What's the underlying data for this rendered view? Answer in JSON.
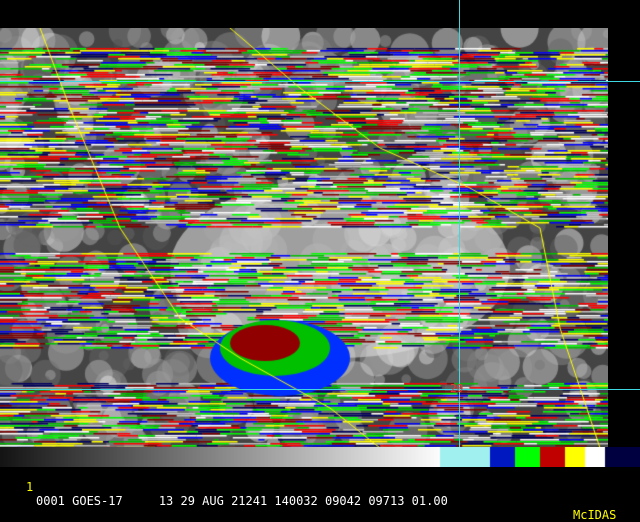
{
  "status_bar": {
    "frame_number": "1",
    "text": "0001 GOES-17     13 29 AUG 21241 140032 09042 09713 01.00",
    "brand": "McIDAS"
  },
  "grid_label": "20",
  "colors": {
    "grid": "#3fd8e0",
    "border": "#ffff00",
    "brand": "#ffff00",
    "label": "#ff3030"
  }
}
